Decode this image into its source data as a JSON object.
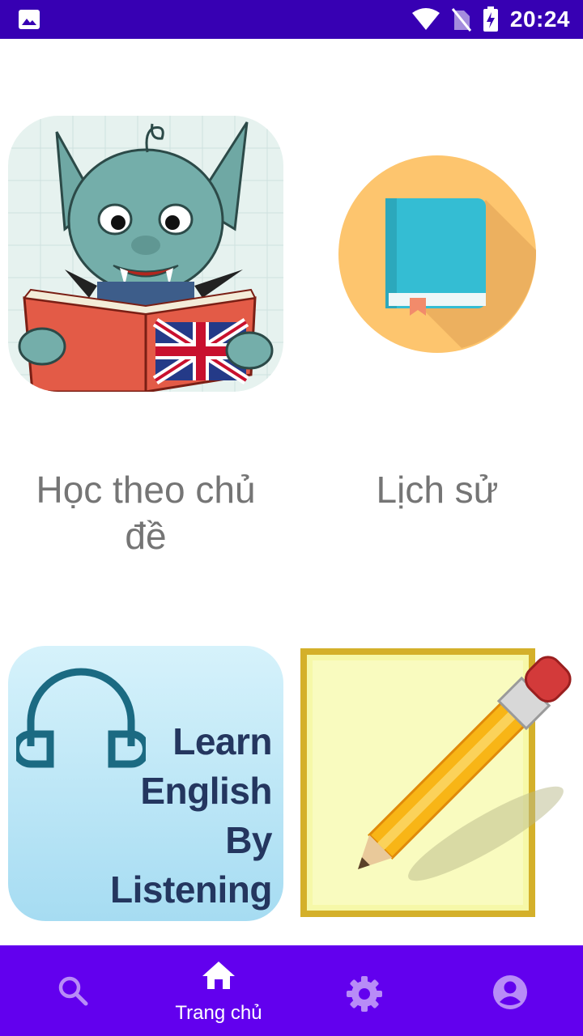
{
  "status_bar": {
    "time": "20:24",
    "icons": [
      "image-icon",
      "wifi-icon",
      "no-sim-icon",
      "battery-charging-icon"
    ]
  },
  "tiles": [
    {
      "label": "Học theo chủ đề",
      "icon": "goblin-reading-book-image"
    },
    {
      "label": "Lịch sử",
      "icon": "book-icon"
    },
    {
      "label": "",
      "icon": "learn-english-by-listening-image",
      "image_text": [
        "Learn",
        "English",
        "By",
        "Listening"
      ]
    },
    {
      "label": "",
      "icon": "notepad-pencil-icon"
    }
  ],
  "bottom_nav": {
    "items": [
      {
        "icon": "search-icon",
        "label": ""
      },
      {
        "icon": "home-icon",
        "label": "Trang chủ",
        "active": true
      },
      {
        "icon": "settings-icon",
        "label": ""
      },
      {
        "icon": "account-icon",
        "label": ""
      }
    ]
  },
  "colors": {
    "status_bar": "#3700b3",
    "bottom_nav": "#6200ee",
    "label_text": "#757575"
  }
}
